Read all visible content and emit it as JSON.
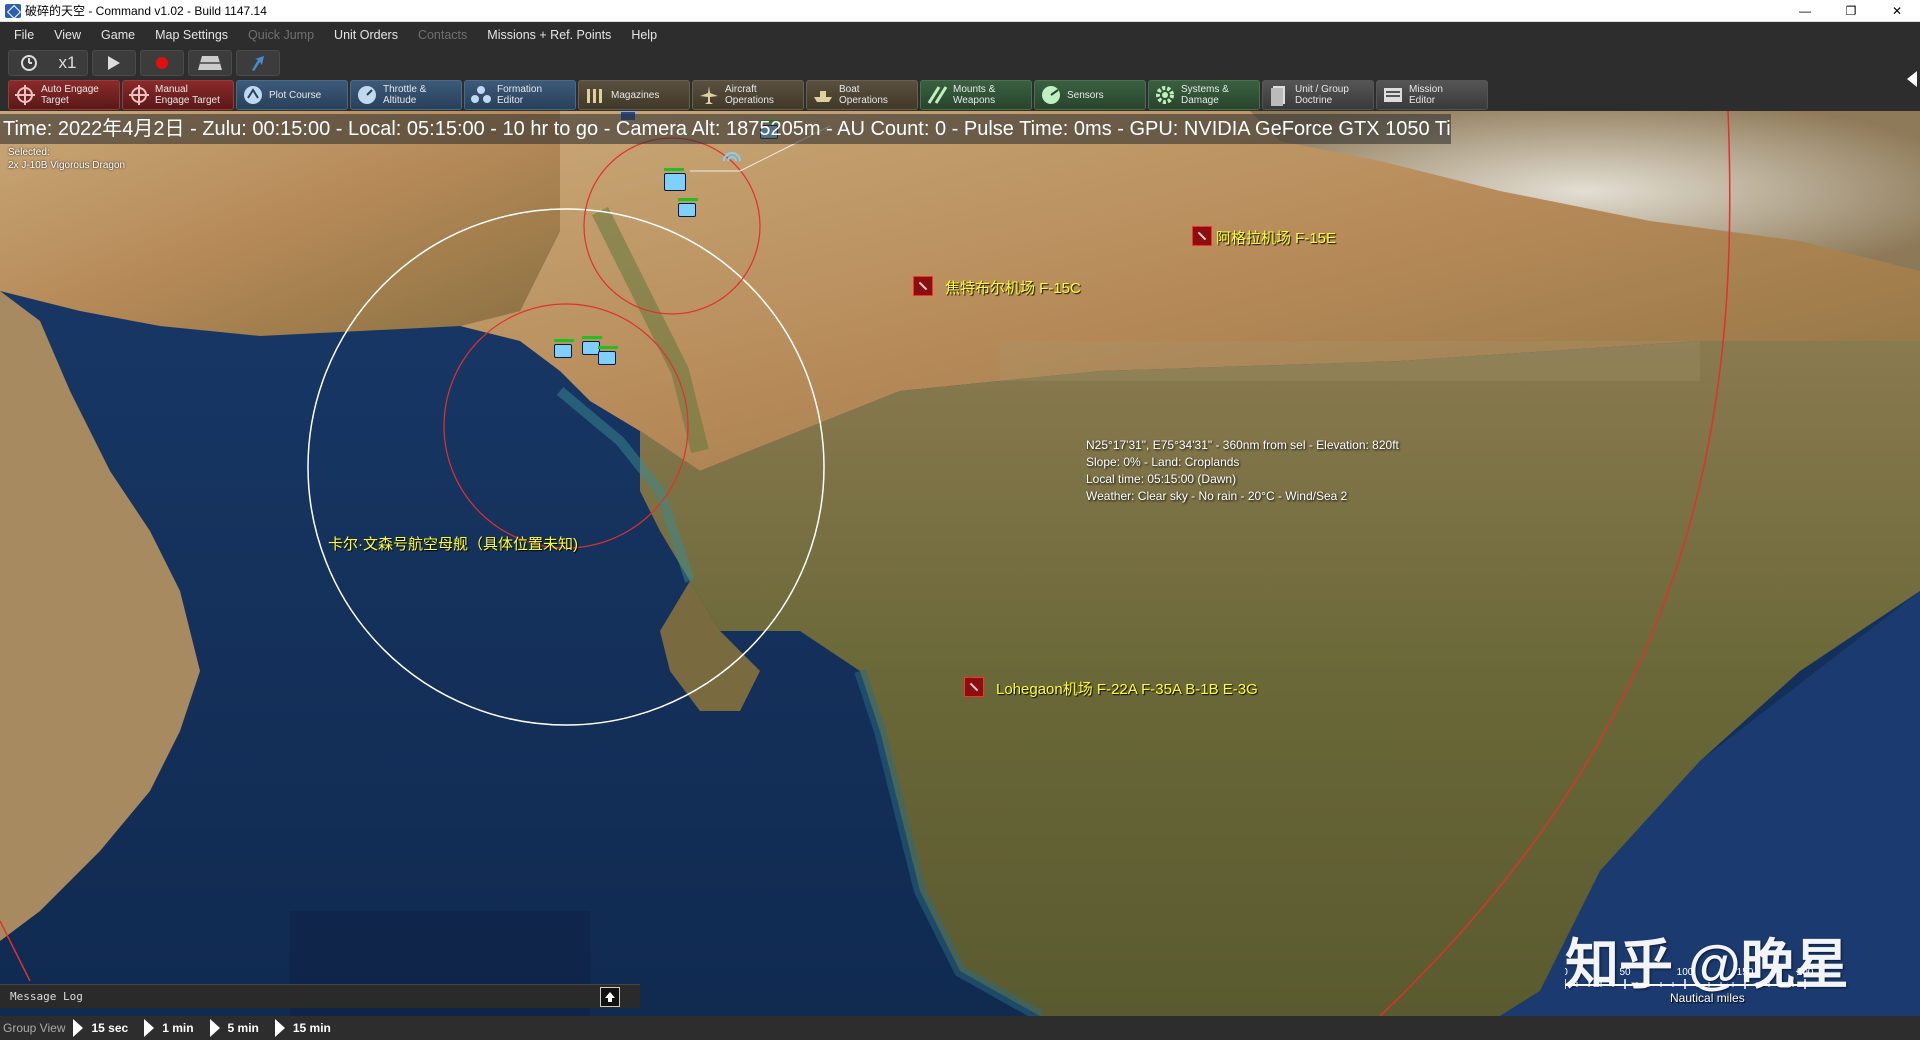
{
  "window": {
    "title": "破碎的天空 - Command v1.02 - Build 1147.14",
    "controls": [
      "—",
      "❐",
      "✕"
    ]
  },
  "menu": [
    {
      "label": "File",
      "enabled": true
    },
    {
      "label": "View",
      "enabled": true
    },
    {
      "label": "Game",
      "enabled": true
    },
    {
      "label": "Map Settings",
      "enabled": true
    },
    {
      "label": "Quick Jump",
      "enabled": false
    },
    {
      "label": "Unit Orders",
      "enabled": true
    },
    {
      "label": "Contacts",
      "enabled": false
    },
    {
      "label": "Missions + Ref. Points",
      "enabled": true
    },
    {
      "label": "Help",
      "enabled": true
    }
  ],
  "toolbar1": {
    "time_compression": "x1"
  },
  "toolbar2": [
    {
      "label": "Auto Engage\nTarget",
      "icon": "crosshair-icon",
      "style": "red"
    },
    {
      "label": "Manual\nEngage Target",
      "icon": "crosshair-icon",
      "style": "red"
    },
    {
      "label": "Plot Course",
      "icon": "waypoint-icon",
      "style": "blue"
    },
    {
      "label": "Throttle &\nAltitude",
      "icon": "throttle-icon",
      "style": "blue"
    },
    {
      "label": "Formation\nEditor",
      "icon": "formation-icon",
      "style": "blue"
    },
    {
      "label": "Magazines",
      "icon": "magazine-icon",
      "style": "tan"
    },
    {
      "label": "Aircraft\nOperations",
      "icon": "aircraft-icon",
      "style": "tan"
    },
    {
      "label": "Boat\nOperations",
      "icon": "boat-icon",
      "style": "tan"
    },
    {
      "label": "Mounts &\nWeapons",
      "icon": "weapons-icon",
      "style": "green"
    },
    {
      "label": "Sensors",
      "icon": "sensor-icon",
      "style": "green"
    },
    {
      "label": "Systems &\nDamage",
      "icon": "gear-icon",
      "style": "green"
    },
    {
      "label": "Unit / Group\nDoctrine",
      "icon": "doctrine-icon",
      "style": "gray"
    },
    {
      "label": "Mission\nEditor",
      "icon": "mission-icon",
      "style": "gray"
    }
  ],
  "status": {
    "text": "Time: 2022年4月2日 - Zulu: 00:15:00 - Local: 05:15:00 - 10 hr to go -  Camera Alt: 1875205m  - AU Count: 0 - Pulse Time: 0ms - GPU: NVIDIA GeForce GTX 1050 Ti"
  },
  "selection": {
    "heading": "Selected:",
    "unit": "2x J-10B Vigorous Dragon"
  },
  "map_labels": {
    "agra": "阿格拉机场 F-15E",
    "jaisalmer": "焦特布尔机场 F-15C",
    "lohegaon": "Lohegaon机场 F-22A F-35A B-1B E-3G",
    "carrier": "卡尔·文森号航空母舰（具体位置未知)"
  },
  "cursor_info": {
    "line1": "N25°17'31\", E75°34'31\" - 360nm from sel - Elevation: 820ft",
    "line2": "Slope: 0%  - Land: Croplands",
    "line3": "Local time: 05:15:00 (Dawn)",
    "line4": "Weather: Clear sky - No rain - 20°C - Wind/Sea 2"
  },
  "message_log": {
    "label": "Message Log"
  },
  "bottom": {
    "group_view": "Group View",
    "steps": [
      "15 sec",
      "1 min",
      "5 min",
      "15 min"
    ]
  },
  "scale": {
    "unit": "Nautical miles",
    "ticks": [
      "0",
      "50",
      "100",
      "150",
      "200"
    ]
  },
  "watermark": "知乎 @晚星",
  "colors": {
    "label_yellow": "#ffff33",
    "range_ring_red": "#e03030",
    "range_ring_white": "#ffffff",
    "friendly_unit": "#7fd0ff",
    "hostile_base": "#8a1010"
  }
}
